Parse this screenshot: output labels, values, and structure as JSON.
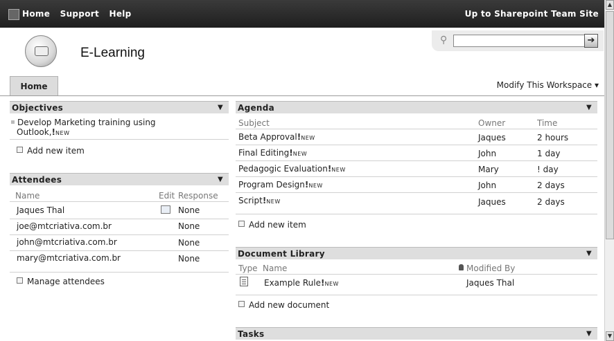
{
  "topnav": {
    "home": "Home",
    "support": "Support",
    "help": "Help",
    "up_link": "Up to Sharepoint Team Site"
  },
  "site": {
    "title": "E-Learning"
  },
  "search": {
    "value": "",
    "go_symbol": "➔"
  },
  "tabs": {
    "home": "Home"
  },
  "modify": "Modify This Workspace ▾",
  "new_badge": "NEW",
  "objectives": {
    "title": "Objectives",
    "items": [
      {
        "line1": "Develop Marketing training using",
        "line2": "Outlook,"
      }
    ],
    "add": "Add new item"
  },
  "attendees": {
    "title": "Attendees",
    "col_name": "Name",
    "col_edit": "Edit",
    "col_response": "Response",
    "rows": [
      {
        "name": "Jaques Thal",
        "response": "None"
      },
      {
        "name": "joe@mtcriativa.com.br",
        "response": "None"
      },
      {
        "name": "john@mtcriativa.com.br",
        "response": "None"
      },
      {
        "name": "mary@mtcriativa.com.br",
        "response": "None"
      }
    ],
    "manage": "Manage attendees"
  },
  "agenda": {
    "title": "Agenda",
    "col_subject": "Subject",
    "col_owner": "Owner",
    "col_time": "Time",
    "rows": [
      {
        "subject": "Beta Approval",
        "owner": "Jaques",
        "time": "2 hours"
      },
      {
        "subject": "Final Editing",
        "owner": "John",
        "time": "1 day"
      },
      {
        "subject": "Pedagogic Evaluation",
        "owner": "Mary",
        "time": "! day"
      },
      {
        "subject": "Program Design",
        "owner": "John",
        "time": "2 days"
      },
      {
        "subject": "Script",
        "owner": "Jaques",
        "time": "2 days"
      }
    ],
    "add": "Add new item"
  },
  "doclib": {
    "title": "Document Library",
    "col_type": "Type",
    "col_name": "Name",
    "col_modified": "Modified By",
    "rows": [
      {
        "name": "Example Rule",
        "modified_by": "Jaques Thal"
      }
    ],
    "add": "Add new document"
  },
  "tasks": {
    "title": "Tasks"
  },
  "colors": {
    "topbar": "#2a2a2a",
    "pane_header": "#dedede",
    "tab": "#dcdcdc"
  }
}
